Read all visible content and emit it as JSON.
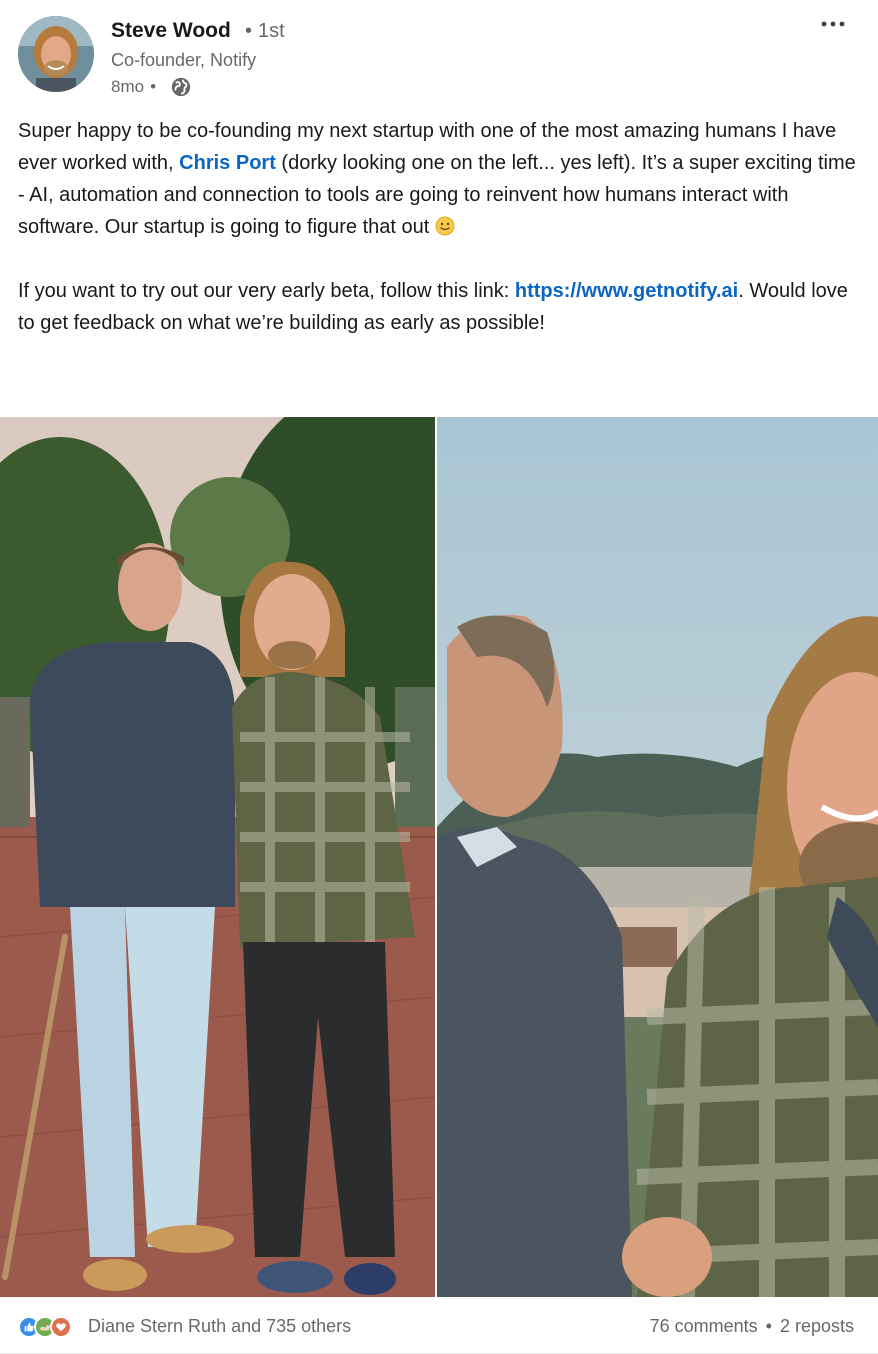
{
  "post": {
    "author": {
      "name": "Steve Wood",
      "degree": "1st",
      "headline": "Co-founder, Notify",
      "age": "8mo",
      "visibility_icon": "globe-icon",
      "avatar_icon": "avatar"
    },
    "menu_icon": "more-horizontal-icon",
    "text": {
      "p1_before_mention": "Super happy to be co-founding my next startup with one of the most amazing humans I have ever worked with, ",
      "mention": "Chris Port",
      "p1_after_mention": " (dorky looking one on the left... yes left). It’s a super exciting time - AI, automation and connection to tools are going to reinvent how humans interact with software.  Our startup is going to figure that out ",
      "emoji": "slightly-smiling-face",
      "p2_before_link": "If you want to try out our very early beta, follow this link: ",
      "link": "https://www.getnotify.ai",
      "p2_after_link": ". Would love to get feedback on what we’re building as early as possible!"
    },
    "images": [
      {
        "name": "photo-two-men-standing-on-brick-street"
      },
      {
        "name": "photo-selfie-two-men-mountain-view"
      }
    ],
    "social": {
      "reactions": [
        "like-icon",
        "support-icon",
        "love-icon"
      ],
      "reactors": "Diane Stern Ruth and 735 others",
      "comments": "76 comments",
      "separator": "•",
      "reposts": "2 reposts"
    }
  },
  "colors": {
    "link": "#0a66c2",
    "like": "#378fe9",
    "support": "#6dae4f",
    "love": "#df704d"
  }
}
